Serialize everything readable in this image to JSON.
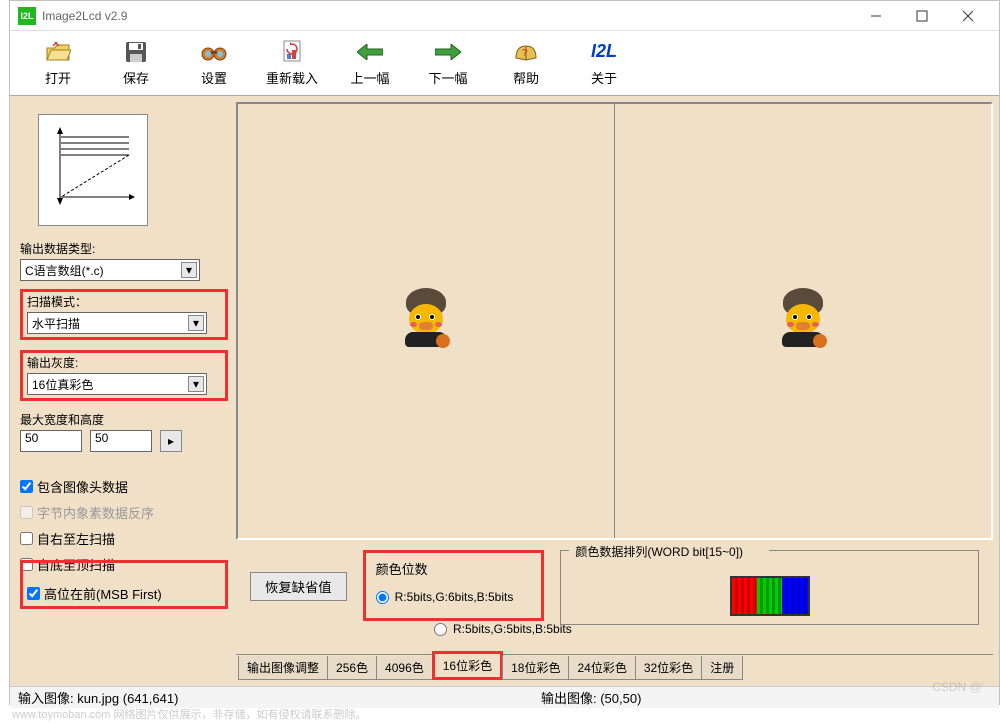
{
  "window": {
    "app_icon_text": "I2L",
    "title": "Image2Lcd v2.9"
  },
  "toolbar": {
    "open": "打开",
    "save": "保存",
    "settings": "设置",
    "reload": "重新载入",
    "prev": "上一幅",
    "next": "下一幅",
    "help": "帮助",
    "about": "关于",
    "about_icon": "I2L"
  },
  "left": {
    "output_type_label": "输出数据类型:",
    "output_type_value": "C语言数组(*.c)",
    "scan_mode_label": "扫描模式：",
    "scan_mode_value": "水平扫描",
    "output_gray_label": "输出灰度:",
    "output_gray_value": "16位真彩色",
    "max_dims_label": "最大宽度和高度",
    "width_value": "50",
    "height_value": "50",
    "chk_header": "包含图像头数据",
    "chk_byte_reverse": "字节内象素数据反序",
    "chk_rtl": "自右至左扫描",
    "chk_btt": "自底至顶扫描",
    "chk_msb": "高位在前(MSB First)"
  },
  "bottom": {
    "restore_defaults": "恢复缺省值",
    "color_bits_title": "颜色位数",
    "radio1": "R:5bits,G:6bits,B:5bits",
    "radio2": "R:5bits,G:5bits,B:5bits",
    "arrange_title": "颜色数据排列(WORD bit[15~0])"
  },
  "tabs": {
    "t1": "输出图像调整",
    "t2": "256色",
    "t3": "4096色",
    "t4": "16位彩色",
    "t5": "18位彩色",
    "t6": "24位彩色",
    "t7": "32位彩色",
    "t8": "注册"
  },
  "status": {
    "input": "输入图像:   kun.jpg  (641,641)",
    "output": "输出图像:   (50,50)"
  },
  "watermark": "www.toymoban.com 网络图片仅供展示，非存储，如有侵权请联系删除。",
  "csdn": "CSDN @'"
}
